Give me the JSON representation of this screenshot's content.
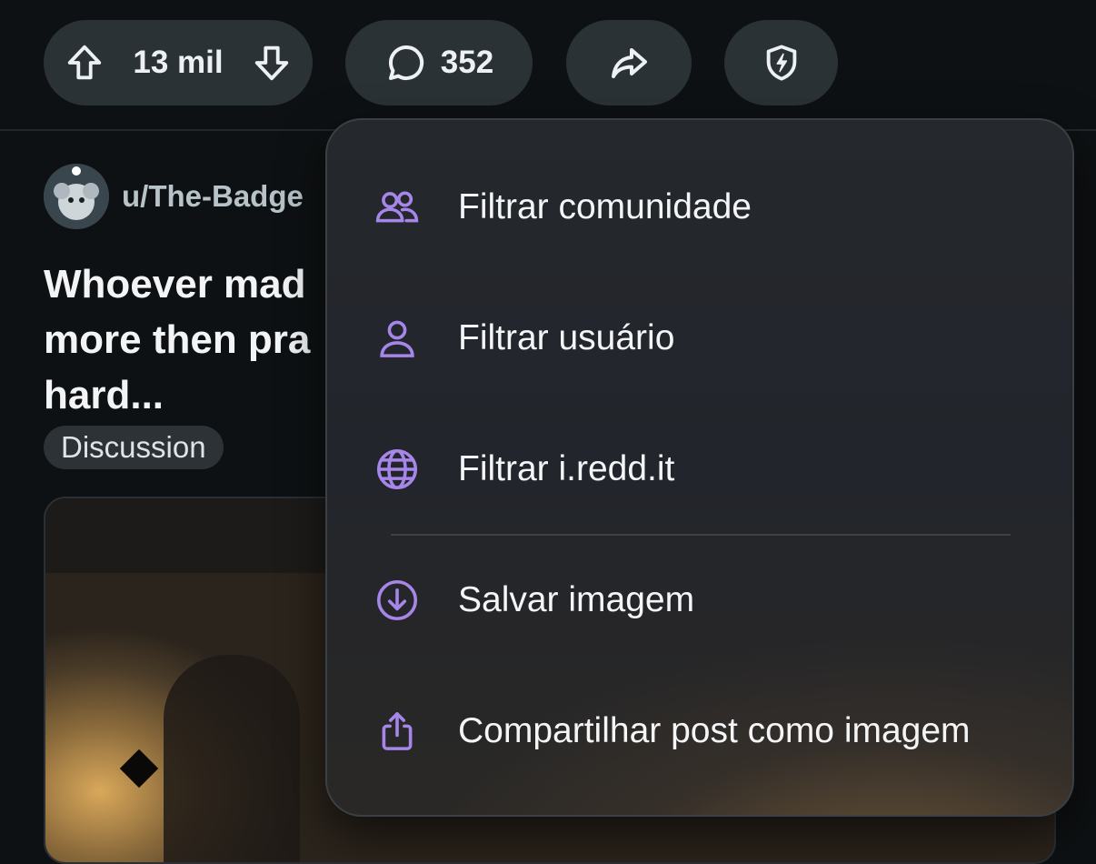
{
  "action_bar": {
    "vote_count": "13 mil",
    "comment_count": "352",
    "icons": [
      "upvote-icon",
      "downvote-icon",
      "comment-icon",
      "share-icon",
      "mod-shield-icon"
    ]
  },
  "post": {
    "author": "u/The-Badge",
    "title": "Whoever mad more then pra hard...",
    "title_lines": [
      "Whoever mad",
      "more then pra",
      "hard..."
    ],
    "flair": "Discussion"
  },
  "menu": {
    "accent_color": "#a686e8",
    "items": [
      {
        "label": "Filtrar comunidade",
        "icon": "community-icon"
      },
      {
        "label": "Filtrar usuário",
        "icon": "user-icon"
      },
      {
        "label": "Filtrar i.redd.it",
        "icon": "globe-icon"
      },
      {
        "label": "Salvar imagem",
        "icon": "download-circle-icon"
      },
      {
        "label": "Compartilhar post como imagem",
        "icon": "share-upload-icon"
      }
    ]
  }
}
